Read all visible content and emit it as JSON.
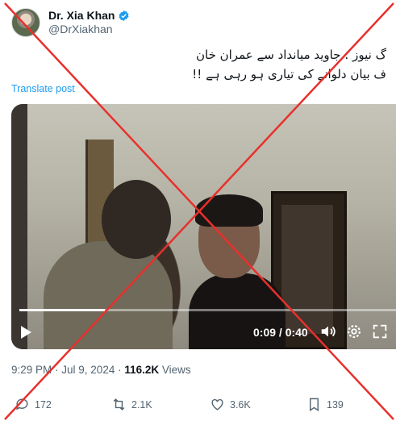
{
  "author": {
    "display_name": "Dr. Xia Khan",
    "handle": "@DrXiakhan",
    "verified": true,
    "verified_color": "#1d9bf0"
  },
  "tweet": {
    "text_line1": "گ نیوز : جاوید میانداد سے عمران خان",
    "text_line2": "ف بیان دلوانے کی تیاری ہو رہی ہے !!",
    "translate_label": "Translate post"
  },
  "video": {
    "timecode": "0:09 / 0:40",
    "progress": 0.225,
    "icons": [
      "play-icon",
      "volume-icon",
      "settings-icon",
      "fullscreen-icon"
    ]
  },
  "meta": {
    "time": "9:29 PM",
    "separator": " · ",
    "date": "Jul 9, 2024",
    "views_count": "116.2K",
    "views_label": "Views"
  },
  "actions": {
    "replies": "172",
    "reposts": "2.1K",
    "likes": "3.6K",
    "bookmarks": "139"
  },
  "overlay": {
    "type": "red-cross",
    "color": "#e8302c"
  }
}
